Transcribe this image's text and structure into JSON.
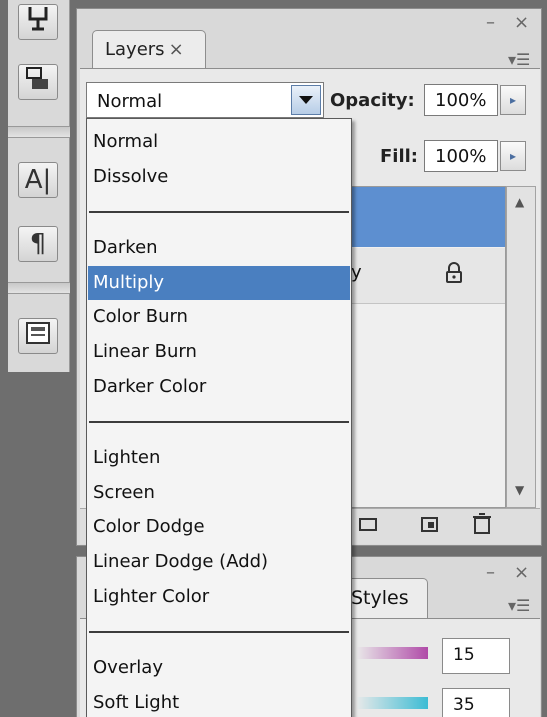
{
  "panel": {
    "tab_label": "Layers",
    "tab_close": "×",
    "minimize_glyph": "–",
    "close_glyph": "×",
    "menu_glyph": "▾☰"
  },
  "controls": {
    "blend_mode_value": "Normal",
    "opacity_label": "Opacity:",
    "opacity_value": "100%",
    "fill_label": "Fill:",
    "fill_value": "100%",
    "stepper_glyph": "▸"
  },
  "layers": {
    "row2_partial": "y",
    "lock_icon": "lock-icon"
  },
  "styles_panel": {
    "tab_label": "Styles",
    "field1_value": "15",
    "field2_value": "35",
    "swatch1_color": "#b04aa8",
    "swatch2_color": "#3cbcd4"
  },
  "blend_menu": {
    "groups": [
      [
        "Normal",
        "Dissolve"
      ],
      [
        "Darken",
        "Multiply",
        "Color Burn",
        "Linear Burn",
        "Darker Color"
      ],
      [
        "Lighten",
        "Screen",
        "Color Dodge",
        "Linear Dodge (Add)",
        "Lighter Color"
      ],
      [
        "Overlay",
        "Soft Light"
      ]
    ],
    "highlighted": "Multiply",
    "highlight_color": "#4a7fc0"
  },
  "icons": {
    "tools": [
      "puppet-icon",
      "stamp-icon",
      "character-icon",
      "paragraph-icon",
      "layer-comps-icon"
    ],
    "footer": [
      "new-group-icon",
      "new-layer-icon",
      "trash-icon"
    ]
  }
}
